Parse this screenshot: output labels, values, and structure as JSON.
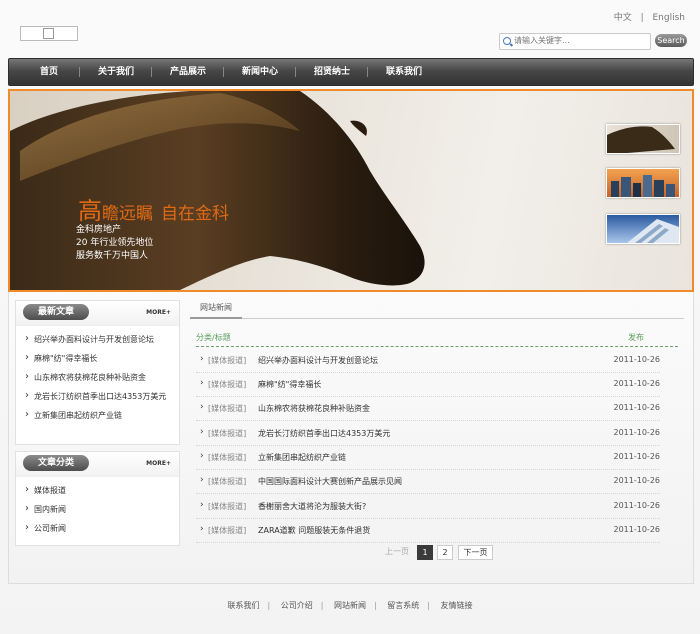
{
  "header": {
    "lang": {
      "zh": "中文",
      "sep": "|",
      "en": "English"
    },
    "search": {
      "placeholder": "请输入关键字...",
      "button": "Search"
    }
  },
  "nav": [
    "首页",
    "关于我们",
    "产品展示",
    "新闻中心",
    "招贤纳士",
    "联系我们"
  ],
  "banner": {
    "slogan_big": "高",
    "slogan_rest": "瞻远瞩",
    "slogan_2": "自在金科",
    "lines": [
      "金科房地产",
      "20 年行业领先地位",
      "服务数千万中国人"
    ]
  },
  "latest": {
    "title": "最新文章",
    "more": "MORE+",
    "items": [
      "绍兴举办面料设计与开发创意论坛",
      "麻棉\"纺\"得幸福长",
      "山东棉农将获棉花良种补贴资金",
      "龙岩长汀纺织首季出口达4353万美元",
      "立新集团串起纺织产业链"
    ]
  },
  "categories": {
    "title": "文章分类",
    "more": "MORE+",
    "items": [
      "媒体报道",
      "国内新闻",
      "公司新闻"
    ]
  },
  "news": {
    "tab": "网站新闻",
    "col_title": "分类/标题",
    "col_date": "发布",
    "rows": [
      {
        "cat": "[媒体报道]",
        "title": "绍兴举办面料设计与开发创意论坛",
        "date": "2011-10-26"
      },
      {
        "cat": "[媒体报道]",
        "title": "麻棉\"纺\"得幸福长",
        "date": "2011-10-26"
      },
      {
        "cat": "[媒体报道]",
        "title": "山东棉农将获棉花良种补贴资金",
        "date": "2011-10-26"
      },
      {
        "cat": "[媒体报道]",
        "title": "龙岩长汀纺织首季出口达4353万美元",
        "date": "2011-10-26"
      },
      {
        "cat": "[媒体报道]",
        "title": "立新集团串起纺织产业链",
        "date": "2011-10-26"
      },
      {
        "cat": "[媒体报道]",
        "title": "中国国际面料设计大赛创新产品展示见闻",
        "date": "2011-10-26"
      },
      {
        "cat": "[媒体报道]",
        "title": "香榭丽舍大道将沦为服装大街?",
        "date": "2011-10-26"
      },
      {
        "cat": "[媒体报道]",
        "title": "ZARA道歉 问题服装无条件退货",
        "date": "2011-10-26"
      }
    ],
    "pager": {
      "prev": "上一页",
      "p1": "1",
      "p2": "2",
      "next": "下一页"
    }
  },
  "footer": [
    "联系我们",
    "公司介绍",
    "网站新闻",
    "留言系统",
    "友情链接"
  ],
  "colors": {
    "accent": "#f08a2b",
    "nav": "#474747",
    "green": "#5aa05a"
  }
}
